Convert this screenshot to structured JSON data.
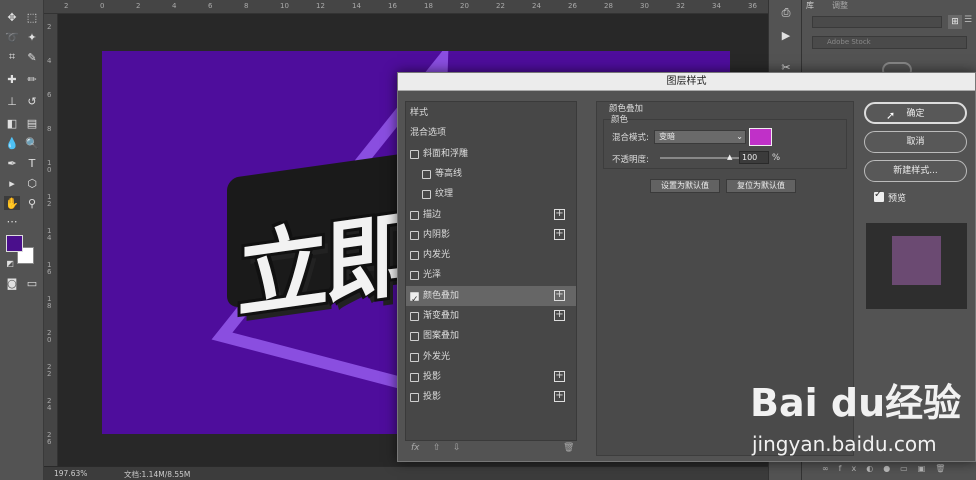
{
  "status": {
    "zoom": "197.63%",
    "doc": "文档:1.14M/8.55M"
  },
  "ruler": {
    "top": [
      "2",
      "0",
      "2",
      "4",
      "6",
      "8",
      "10",
      "12",
      "14",
      "16",
      "18",
      "20",
      "22",
      "24",
      "26",
      "28",
      "30",
      "32",
      "34",
      "36"
    ],
    "left": [
      "2",
      "4",
      "6",
      "8",
      "1 0",
      "1 2",
      "1 4",
      "1 6",
      "1 8",
      "2 0",
      "2 2",
      "2 4",
      "2 6"
    ]
  },
  "artwork": {
    "title_text": "立即",
    "bg_color": "#4e0d9c",
    "accent_color": "#8a4ee0"
  },
  "right_panel": {
    "tab_library": "库",
    "tab_adjust": "调整",
    "search_placeholder": "Adobe Stock"
  },
  "dialog": {
    "title": "图层样式",
    "styles": [
      {
        "label": "样式",
        "checkbox": false,
        "checked": false,
        "plus": false,
        "indent": false,
        "selected": false
      },
      {
        "label": "混合选项",
        "checkbox": false,
        "checked": false,
        "plus": false,
        "indent": false,
        "selected": false
      },
      {
        "label": "斜面和浮雕",
        "checkbox": true,
        "checked": false,
        "plus": false,
        "indent": false,
        "selected": false
      },
      {
        "label": "等高线",
        "checkbox": true,
        "checked": false,
        "plus": false,
        "indent": true,
        "selected": false
      },
      {
        "label": "纹理",
        "checkbox": true,
        "checked": false,
        "plus": false,
        "indent": true,
        "selected": false
      },
      {
        "label": "描边",
        "checkbox": true,
        "checked": false,
        "plus": true,
        "indent": false,
        "selected": false
      },
      {
        "label": "内阴影",
        "checkbox": true,
        "checked": false,
        "plus": true,
        "indent": false,
        "selected": false
      },
      {
        "label": "内发光",
        "checkbox": true,
        "checked": false,
        "plus": false,
        "indent": false,
        "selected": false
      },
      {
        "label": "光泽",
        "checkbox": true,
        "checked": false,
        "plus": false,
        "indent": false,
        "selected": false
      },
      {
        "label": "颜色叠加",
        "checkbox": true,
        "checked": true,
        "plus": true,
        "indent": false,
        "selected": true
      },
      {
        "label": "渐变叠加",
        "checkbox": true,
        "checked": false,
        "plus": true,
        "indent": false,
        "selected": false
      },
      {
        "label": "图案叠加",
        "checkbox": true,
        "checked": false,
        "plus": false,
        "indent": false,
        "selected": false
      },
      {
        "label": "外发光",
        "checkbox": true,
        "checked": false,
        "plus": false,
        "indent": false,
        "selected": false
      },
      {
        "label": "投影",
        "checkbox": true,
        "checked": false,
        "plus": true,
        "indent": false,
        "selected": false
      },
      {
        "label": "投影",
        "checkbox": true,
        "checked": false,
        "plus": true,
        "indent": false,
        "selected": false
      }
    ],
    "footer": {
      "fx": "fx",
      "up": "⇧",
      "down": "⇩",
      "trash": "🗑"
    },
    "section_title": "颜色叠加",
    "group_title": "颜色",
    "blend_label": "混合模式:",
    "blend_value": "变暗",
    "overlay_color": "#c030c8",
    "opacity_label": "不透明度:",
    "opacity_value": "100",
    "opacity_unit": "%",
    "btn_set_default": "设置为默认值",
    "btn_reset_default": "复位为默认值",
    "btn_ok": "确定",
    "btn_cancel": "取消",
    "btn_new_style": "新建样式...",
    "preview_label": "预览"
  },
  "watermark": {
    "brand": "Bai du经验",
    "url": "jingyan.baidu.com"
  }
}
